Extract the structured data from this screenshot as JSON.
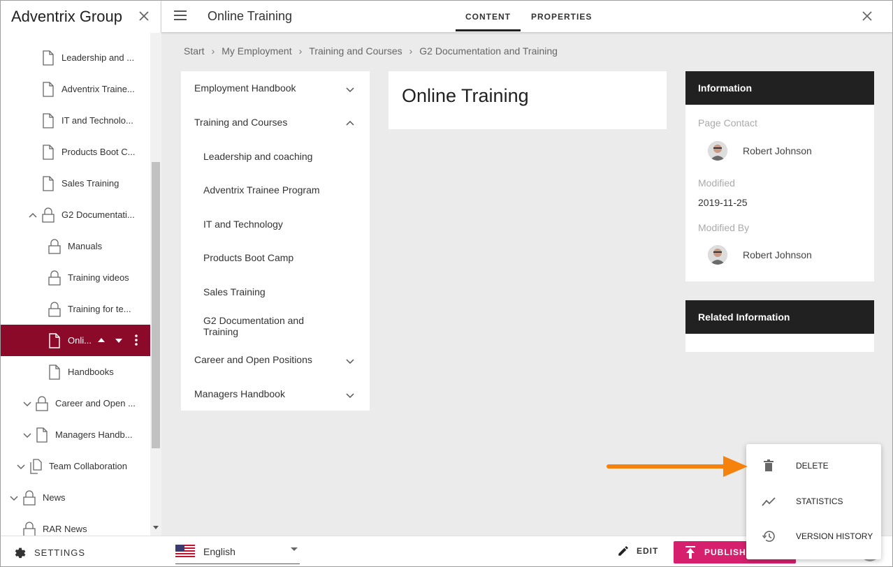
{
  "sidebar": {
    "title": "Adventrix Group",
    "tree": [
      {
        "label": "Leadership and ...",
        "icon": "page-icon"
      },
      {
        "label": "Adventrix Traine...",
        "icon": "page-icon"
      },
      {
        "label": "IT and Technolo...",
        "icon": "page-icon"
      },
      {
        "label": "Products Boot C...",
        "icon": "page-icon"
      },
      {
        "label": "Sales Training",
        "icon": "page-icon"
      },
      {
        "label": "G2 Documentati...",
        "icon": "lock-icon",
        "expanded": true
      },
      {
        "label": "Manuals",
        "icon": "lock-icon"
      },
      {
        "label": "Training videos",
        "icon": "lock-icon"
      },
      {
        "label": "Training for te...",
        "icon": "lock-icon"
      },
      {
        "label": "Onli...",
        "icon": "page-icon",
        "selected": true
      },
      {
        "label": "Handbooks",
        "icon": "page-icon"
      },
      {
        "label": "Career and Open ...",
        "icon": "lock-icon",
        "collapsed": true
      },
      {
        "label": "Managers Handb...",
        "icon": "page-icon",
        "collapsed": true
      },
      {
        "label": "Team Collaboration",
        "icon": "pages-icon",
        "collapsed": true
      },
      {
        "label": "News",
        "icon": "lock-icon",
        "collapsed": true
      },
      {
        "label": "RAR News",
        "icon": "lock-icon"
      }
    ]
  },
  "topbar": {
    "page_title": "Online Training",
    "tabs": [
      {
        "label": "CONTENT",
        "active": true
      },
      {
        "label": "PROPERTIES",
        "active": false
      }
    ]
  },
  "breadcrumb": [
    "Start",
    "My Employment",
    "Training and Courses",
    "G2 Documentation and Training"
  ],
  "nav": [
    {
      "label": "Employment Handbook",
      "chevron": "down"
    },
    {
      "label": "Training and Courses",
      "chevron": "up"
    },
    {
      "label": "Leadership and coaching"
    },
    {
      "label": "Adventrix Trainee Program"
    },
    {
      "label": "IT and Technology"
    },
    {
      "label": "Products Boot Camp"
    },
    {
      "label": "Sales Training"
    },
    {
      "label": "G2 Documentation and Training"
    },
    {
      "label": "Career and Open Positions",
      "chevron": "down"
    },
    {
      "label": "Managers Handbook",
      "chevron": "down"
    }
  ],
  "content": {
    "heading": "Online Training"
  },
  "info": {
    "header": "Information",
    "page_contact_label": "Page Contact",
    "page_contact_name": "Robert Johnson",
    "modified_label": "Modified",
    "modified_value": "2019-11-25",
    "modified_by_label": "Modified By",
    "modified_by_name": "Robert Johnson"
  },
  "related": {
    "header": "Related Information"
  },
  "bottombar": {
    "settings_label": "SETTINGS",
    "language": "English",
    "edit_label": "EDIT",
    "publish_label": "PUBLISH"
  },
  "menu": [
    {
      "label": "DELETE",
      "icon": "trash-icon"
    },
    {
      "label": "STATISTICS",
      "icon": "trend-icon"
    },
    {
      "label": "VERSION HISTORY",
      "icon": "history-icon"
    }
  ],
  "colors": {
    "selected_bg": "#8b0a2a",
    "publish_bg": "#d6206d",
    "card_header_bg": "#212121",
    "arrow": "#f5820d"
  }
}
